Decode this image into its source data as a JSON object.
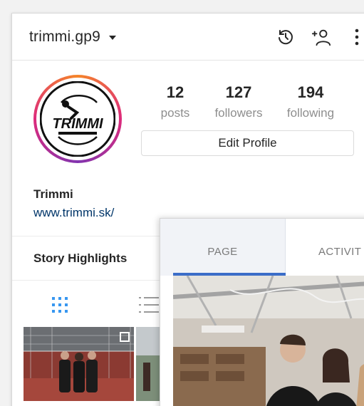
{
  "profile": {
    "username": "trimmi.gp9",
    "stats": [
      {
        "num": "12",
        "label": "posts"
      },
      {
        "num": "127",
        "label": "followers"
      },
      {
        "num": "194",
        "label": "following"
      }
    ],
    "edit_label": "Edit Profile",
    "name": "Trimmi",
    "website": "www.trimmi.sk/",
    "highlights_label": "Story Highlights",
    "logo_text": "TRIMMI"
  },
  "panel": {
    "tabs": [
      {
        "label": "PAGE"
      },
      {
        "label": "ACTIVIT"
      }
    ]
  },
  "colors": {
    "link": "#003569",
    "tab_active": "#3b6dc8",
    "grid_active": "#3897f0"
  }
}
